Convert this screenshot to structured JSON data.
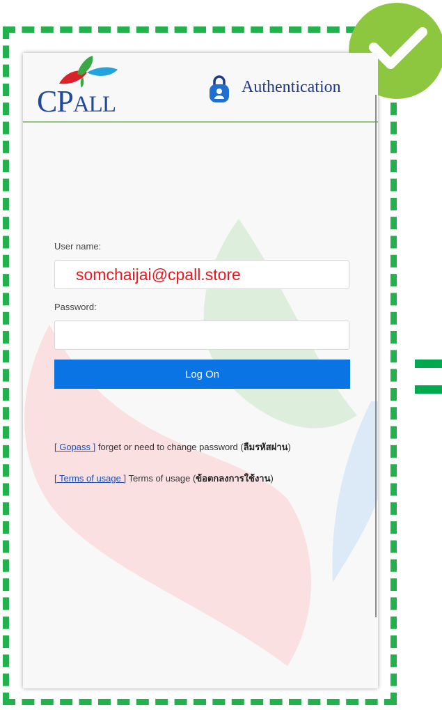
{
  "header": {
    "logo_text_c": "C",
    "logo_text_p": "P",
    "logo_text_all": "ALL",
    "title": "Authentication",
    "lock_icon": "lock-shield-icon"
  },
  "login": {
    "username_label": "User name:",
    "username_value": "somchaijai@cpall.store",
    "password_label": "Password:",
    "password_value": "",
    "logon_button": "Log On"
  },
  "links": {
    "gopass_link": "[ Gopass ]",
    "gopass_text": " forget or need to change password (",
    "gopass_thai": "ลืมรหัสผ่าน",
    "gopass_close": ")",
    "terms_link": "[ Terms of usage ]",
    "terms_text": " Terms of usage (",
    "terms_thai": "ข้อตกลงการใช้งาน",
    "terms_close": ")"
  },
  "colors": {
    "frame_dash": "#22b14c",
    "check_badge": "#8dc63f",
    "logon_button": "#0b74e5",
    "username_text": "#e8181e",
    "logo_blue": "#1e4b9b"
  },
  "icons": {
    "badge": "check-mark-icon",
    "equals": "equals-sign-icon"
  }
}
